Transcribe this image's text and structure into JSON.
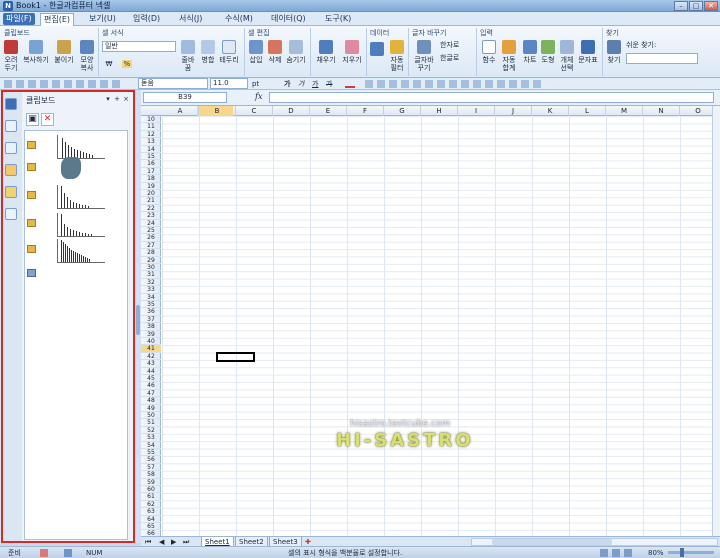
{
  "window": {
    "title": "Book1 - 한글과컴퓨터 넥셀",
    "app_icon": "N",
    "min": "–",
    "max": "□",
    "close": "✕"
  },
  "menu": {
    "file": "파일(F)",
    "items": [
      "편집(E)",
      "보기(U)",
      "입력(D)",
      "서식(J)",
      "수식(M)",
      "데이터(Q)",
      "도구(K)"
    ]
  },
  "ribbon": {
    "clipboard": {
      "title": "클립보드",
      "cut": "오려두기",
      "copy": "복사하기",
      "paste": "붙이기",
      "format_copy": "모양복사"
    },
    "cell_format": {
      "title": "셀 서식",
      "style": "일반",
      "merge": "줄바꿈",
      "merge2": "병합",
      "borders": "테두리",
      "currency": "₩",
      "percent": "%"
    },
    "cell_edit": {
      "title": "셀 편집",
      "insert": "삽입",
      "delete": "삭제",
      "hide": "숨기기"
    },
    "fill": {
      "fill": "채우기",
      "clear": "지우기"
    },
    "data": {
      "title": "데이터",
      "sort": "자동필터",
      "filter_label": "자동필터"
    },
    "char": {
      "title": "글자 바꾸기",
      "hanja": "한자로",
      "hangul": "한글로",
      "char_convert": "글자바꾸기"
    },
    "input": {
      "title": "입력",
      "func": "함수",
      "autosum": "자동합계",
      "chart": "차트",
      "shape": "도형",
      "object": "개체선택",
      "char_table": "문자표"
    },
    "find": {
      "title": "찾기",
      "find": "찾기",
      "quick_find": "쉬운 찾기:"
    }
  },
  "toolbar": {
    "font": "돋움",
    "size": "11.0",
    "unit": "pt",
    "bold": "가",
    "italic": "가",
    "underline": "가",
    "strike": "가"
  },
  "clipboard_pane": {
    "title": "클립보드",
    "items": 5
  },
  "formula_bar": {
    "cell_ref": "B39",
    "fx": "fx",
    "value": ""
  },
  "grid": {
    "columns": [
      "A",
      "B",
      "C",
      "D",
      "E",
      "F",
      "G",
      "H",
      "I",
      "J",
      "K",
      "L",
      "M",
      "N",
      "O"
    ],
    "rows": [
      "10",
      "11",
      "12",
      "13",
      "14",
      "15",
      "16",
      "17",
      "18",
      "19",
      "20",
      "21",
      "22",
      "23",
      "24",
      "25",
      "26",
      "27",
      "28",
      "29",
      "30",
      "31",
      "32",
      "33",
      "34",
      "35",
      "36",
      "37",
      "38",
      "39",
      "40",
      "41",
      "42",
      "43",
      "44",
      "45",
      "46",
      "47",
      "48",
      "49",
      "50",
      "51",
      "52",
      "53",
      "54",
      "55",
      "56",
      "57",
      "58",
      "59",
      "60",
      "61",
      "62",
      "63",
      "64",
      "65",
      "66"
    ],
    "active": "B39"
  },
  "sheets": [
    "Sheet1",
    "Sheet2",
    "Sheet3"
  ],
  "watermark": {
    "url": "hisastro.textcube.com",
    "logo": "HI-SASTRO"
  },
  "status": {
    "mode": "준비",
    "num": "NUM",
    "message": "셀의 표시 형식을 백분율로 설정합니다.",
    "zoom": "80%"
  }
}
